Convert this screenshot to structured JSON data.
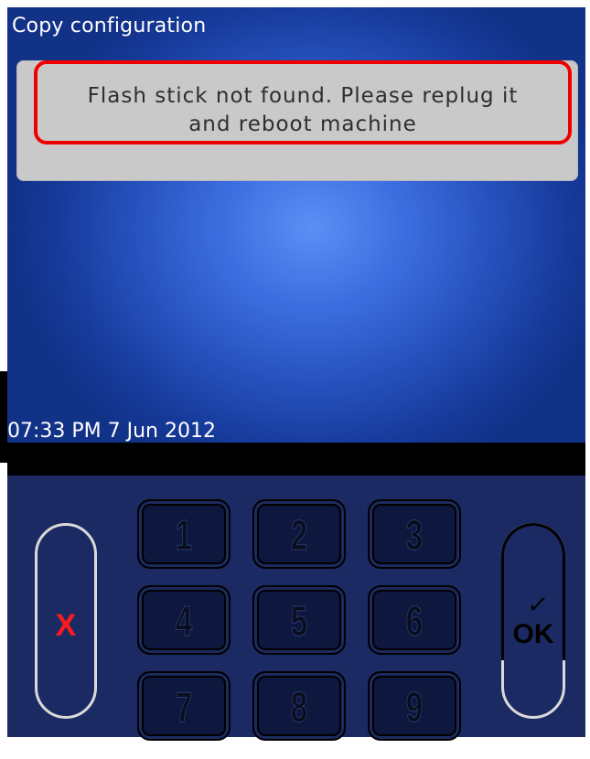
{
  "screen": {
    "title": "Copy configuration",
    "message": {
      "line1": "Flash stick not found. Please replug it",
      "line2": "and reboot machine"
    },
    "datetime": "07:33 PM 7 Jun 2012"
  },
  "keypad": {
    "cancel_label": "X",
    "ok_check": "✓",
    "ok_label": "OK",
    "keys": [
      "1",
      "2",
      "3",
      "4",
      "5",
      "6",
      "7",
      "8",
      "9"
    ]
  },
  "colors": {
    "highlight": "#ee0000",
    "cancel": "#ff1a1a",
    "keypad_bg": "#1c2a63",
    "screen_center": "#5b8ff5",
    "screen_edge": "#123288"
  }
}
